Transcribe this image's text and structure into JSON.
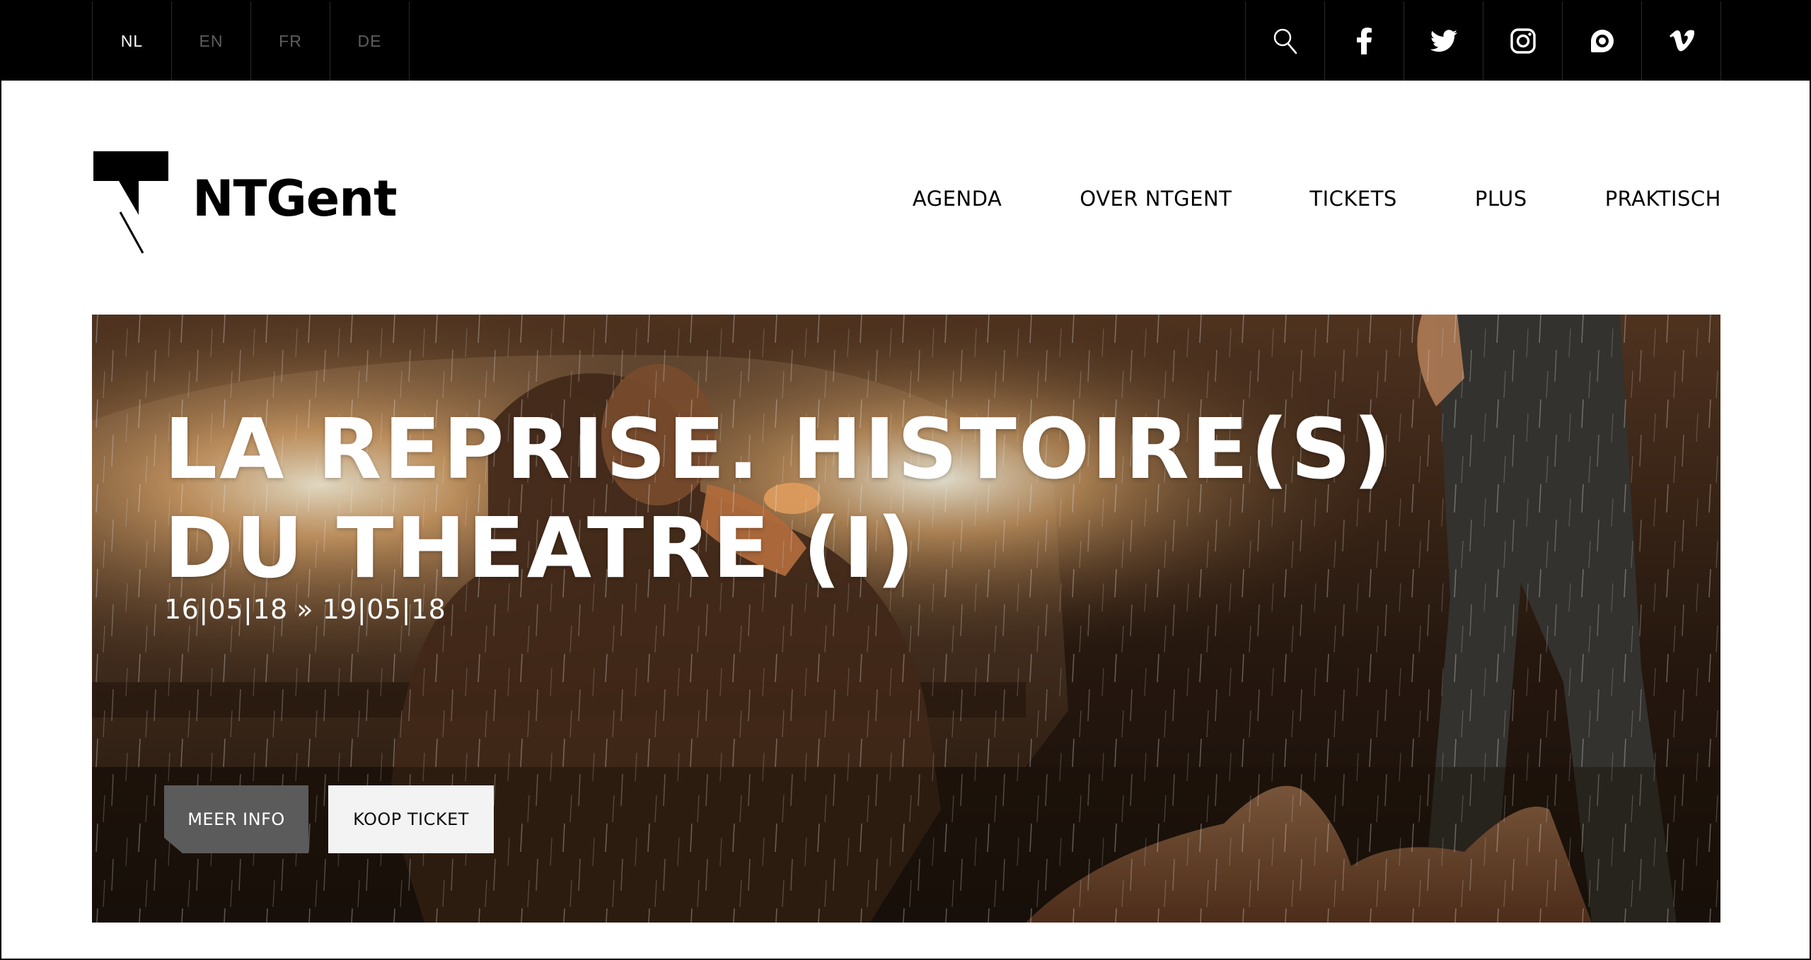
{
  "languages": [
    {
      "code": "NL",
      "active": true
    },
    {
      "code": "EN",
      "active": false
    },
    {
      "code": "FR",
      "active": false
    },
    {
      "code": "DE",
      "active": false
    }
  ],
  "social_icons": [
    "search-icon",
    "facebook-icon",
    "twitter-icon",
    "instagram-icon",
    "issuu-icon",
    "vimeo-icon"
  ],
  "brand": {
    "name": "NTGent"
  },
  "nav": {
    "items": [
      "AGENDA",
      "OVER NTGENT",
      "TICKETS",
      "PLUS",
      "PRAKTISCH"
    ]
  },
  "hero": {
    "title": "LA REPRISE. HISTOIRE(S) DU THEATRE (I)",
    "dates": "16|05|18 » 19|05|18",
    "more_info_label": "MEER INFO",
    "buy_ticket_label": "KOOP TICKET"
  },
  "colors": {
    "topbar_bg": "#000000",
    "lang_active": "#ffffff",
    "lang_inactive": "#5e5e5e",
    "more_info_bg": "#5b5b5b",
    "buy_ticket_bg": "#f3f3f3"
  }
}
